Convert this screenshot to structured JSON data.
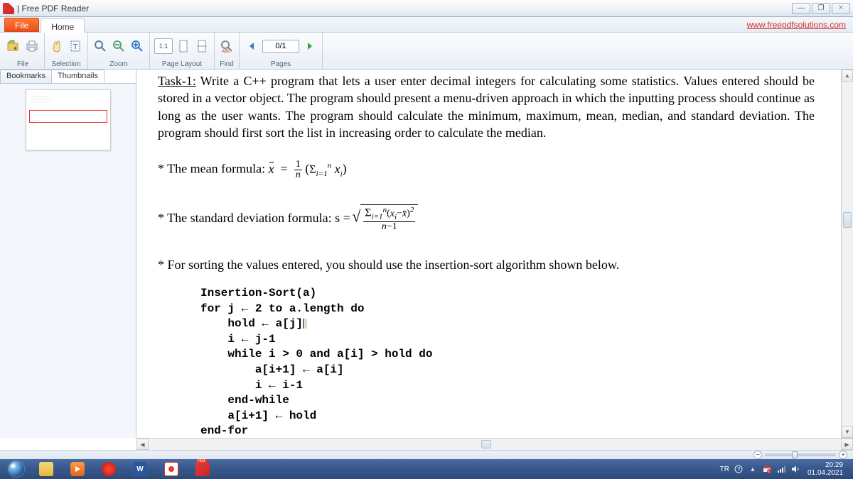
{
  "titlebar": {
    "app_name": "| Free PDF Reader"
  },
  "menubar": {
    "file": "File",
    "home": "Home",
    "link": "www.freepdfsolutions.com"
  },
  "ribbon": {
    "groups": {
      "file": "File",
      "selection": "Selection",
      "zoom": "Zoom",
      "pagelayout": "Page Layout",
      "find": "Find",
      "pages": "Pages"
    },
    "page_indicator": "0/1",
    "fit_label": "1:1"
  },
  "sidebar": {
    "tabs": {
      "bookmarks": "Bookmarks",
      "thumbnails": "Thumbnails"
    }
  },
  "document": {
    "task_label": "Task-1:",
    "task_text": " Write a C++ program that lets a user enter decimal integers for calculating some statistics. Values entered should be stored in a vector object. The program should present a menu-driven approach in which the inputting process should continue as long as the user wants. The program should calculate the minimum, maximum, mean, median, and standard deviation. The program should first sort the list in increasing order to calculate the median.",
    "mean_label": "* The mean formula:  ",
    "stddev_label": "* The standard deviation formula:  s  =  ",
    "sort_note": "* For sorting the values entered, you should use the insertion-sort algorithm shown below.",
    "code": "Insertion-Sort(a)\nfor j ← 2 to a.length do\n    hold ← a[j]\n    i ← j-1\n    while i > 0 and a[i] > hold do\n        a[i+1] ← a[i]\n        i ← i-1\n    end-while\n    a[i+1] ← hold\nend-for"
  },
  "tray": {
    "lang": "TR",
    "time": "20:29",
    "date": "01.04.2021"
  }
}
